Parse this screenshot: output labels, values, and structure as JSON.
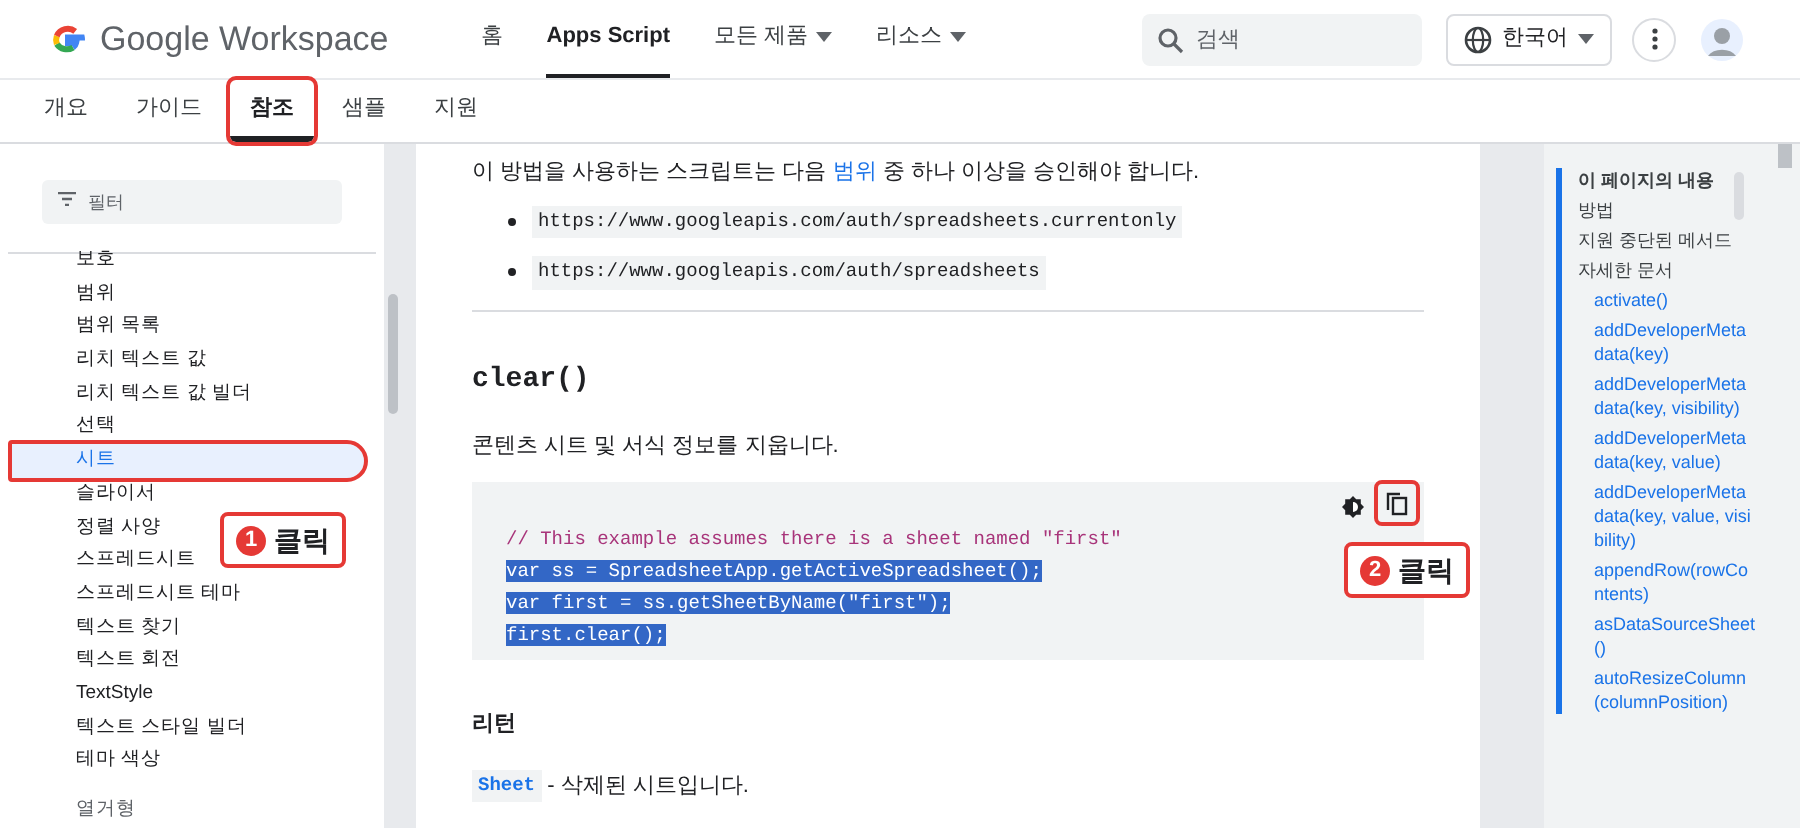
{
  "header": {
    "logo_text": "Google Workspace",
    "nav": [
      {
        "label": "홈",
        "selected": false,
        "dropdown": false
      },
      {
        "label": "Apps Script",
        "selected": true,
        "dropdown": false
      },
      {
        "label": "모든 제품",
        "selected": false,
        "dropdown": true
      },
      {
        "label": "리소스",
        "selected": false,
        "dropdown": true
      }
    ],
    "search": {
      "placeholder": "검색"
    },
    "language": "한국어"
  },
  "tabs": [
    {
      "label": "개요",
      "selected": false
    },
    {
      "label": "가이드",
      "selected": false
    },
    {
      "label": "참조",
      "selected": true
    },
    {
      "label": "샘플",
      "selected": false
    },
    {
      "label": "지원",
      "selected": false
    }
  ],
  "sidebar": {
    "filter": {
      "placeholder": "필터"
    },
    "items": [
      {
        "label": "보호",
        "kind": "item",
        "selected": false
      },
      {
        "label": "범위",
        "kind": "item",
        "selected": false
      },
      {
        "label": "범위 목록",
        "kind": "item",
        "selected": false
      },
      {
        "label": "리치 텍스트 값",
        "kind": "item",
        "selected": false
      },
      {
        "label": "리치 텍스트 값 빌더",
        "kind": "item",
        "selected": false
      },
      {
        "label": "선택",
        "kind": "item",
        "selected": false
      },
      {
        "label": "시트",
        "kind": "item",
        "selected": true
      },
      {
        "label": "슬라이서",
        "kind": "item",
        "selected": false
      },
      {
        "label": "정렬 사양",
        "kind": "item",
        "selected": false
      },
      {
        "label": "스프레드시트",
        "kind": "item",
        "selected": false
      },
      {
        "label": "스프레드시트 테마",
        "kind": "item",
        "selected": false
      },
      {
        "label": "텍스트 찾기",
        "kind": "item",
        "selected": false
      },
      {
        "label": "텍스트 회전",
        "kind": "item",
        "selected": false
      },
      {
        "label": "TextStyle",
        "kind": "item",
        "selected": false
      },
      {
        "label": "텍스트 스타일 빌더",
        "kind": "item",
        "selected": false
      },
      {
        "label": "테마 색상",
        "kind": "item",
        "selected": false
      },
      {
        "label": "열거형",
        "kind": "section"
      }
    ]
  },
  "content": {
    "intro_link": "범위",
    "intro_before": "이 방법을 사용하는 스크립트는 다음 ",
    "intro_after": " 중 하나 이상을 승인해야 합니다.",
    "scopes": [
      "https://www.googleapis.com/auth/spreadsheets.currentonly",
      "https://www.googleapis.com/auth/spreadsheets"
    ],
    "method": "clear()",
    "description": "콘텐츠 시트 및 서식 정보를 지웁니다.",
    "code": [
      {
        "text": "// This example assumes there is a sheet named \"first\"",
        "kind": "comment",
        "highlighted": false
      },
      {
        "text": "var ss = SpreadsheetApp.getActiveSpreadsheet();",
        "kind": "code",
        "highlighted": true
      },
      {
        "text": "var first = ss.getSheetByName(\"first\");",
        "kind": "code",
        "highlighted": true
      },
      {
        "text": "first.clear();",
        "kind": "code",
        "highlighted": true
      }
    ],
    "return_heading": "리턴",
    "return_type": "Sheet",
    "return_text": " - 삭제된 시트입니다."
  },
  "toc": [
    {
      "label": "이 페이지의 내용",
      "kind": "heading"
    },
    {
      "label": "방법",
      "kind": "link"
    },
    {
      "label": "지원 중단된 메서드",
      "kind": "link"
    },
    {
      "label": "자세한 문서",
      "kind": "link"
    },
    {
      "label": "activate()",
      "kind": "sub"
    },
    {
      "label": "addDeveloperMetadata(key)",
      "kind": "sub"
    },
    {
      "label": "addDeveloperMetadata(key, visibility)",
      "kind": "sub"
    },
    {
      "label": "addDeveloperMetadata(key, value)",
      "kind": "sub"
    },
    {
      "label": "addDeveloperMetadata(key, value, visibility)",
      "kind": "sub"
    },
    {
      "label": "appendRow(rowContents)",
      "kind": "sub"
    },
    {
      "label": "asDataSourceSheet()",
      "kind": "sub"
    },
    {
      "label": "autoResizeColumn(columnPosition)",
      "kind": "sub"
    }
  ],
  "callouts": [
    {
      "number": "1",
      "text": "클릭"
    },
    {
      "number": "2",
      "text": "클릭"
    }
  ]
}
